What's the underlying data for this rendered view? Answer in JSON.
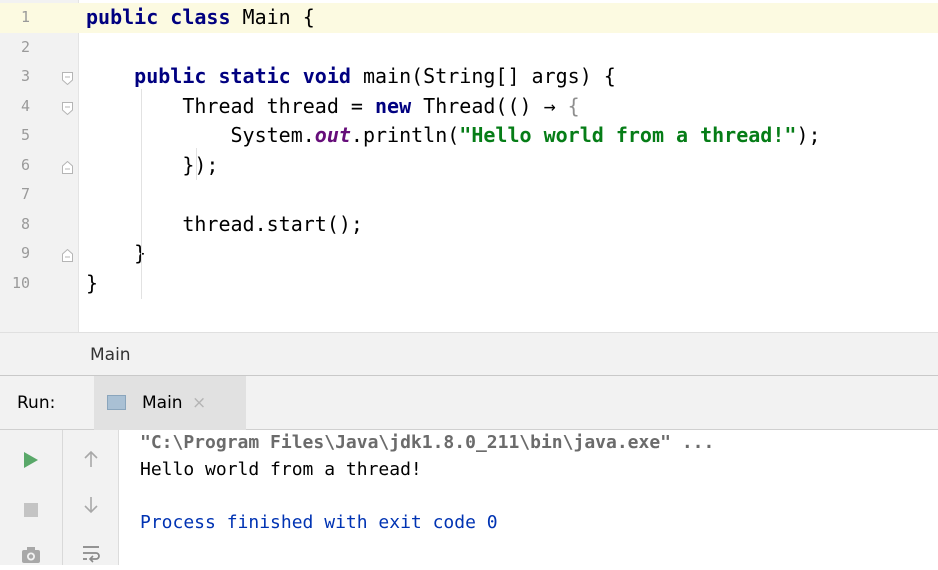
{
  "editor": {
    "lines": [
      {
        "number": "1",
        "parts": [
          {
            "t": "public class ",
            "c": "kw"
          },
          {
            "t": "Main {",
            "c": ""
          }
        ]
      },
      {
        "number": "2",
        "parts": []
      },
      {
        "number": "3",
        "parts": [
          {
            "t": "    ",
            "c": ""
          },
          {
            "t": "public static void ",
            "c": "kw"
          },
          {
            "t": "main(String[] args) {",
            "c": ""
          }
        ]
      },
      {
        "number": "4",
        "parts": [
          {
            "t": "        Thread thread = ",
            "c": ""
          },
          {
            "t": "new ",
            "c": "kw"
          },
          {
            "t": "Thread(() → ",
            "c": ""
          },
          {
            "t": "{",
            "c": "lambda-brace"
          }
        ]
      },
      {
        "number": "5",
        "parts": [
          {
            "t": "            System.",
            "c": ""
          },
          {
            "t": "out",
            "c": "fld"
          },
          {
            "t": ".println(",
            "c": ""
          },
          {
            "t": "\"Hello world from a thread!\"",
            "c": "str"
          },
          {
            "t": ");",
            "c": ""
          }
        ]
      },
      {
        "number": "6",
        "parts": [
          {
            "t": "        });",
            "c": ""
          }
        ]
      },
      {
        "number": "7",
        "parts": []
      },
      {
        "number": "8",
        "parts": [
          {
            "t": "        thread.start();",
            "c": ""
          }
        ]
      },
      {
        "number": "9",
        "parts": [
          {
            "t": "    }",
            "c": ""
          }
        ]
      },
      {
        "number": "10",
        "parts": [
          {
            "t": "}",
            "c": ""
          }
        ]
      }
    ],
    "current_line": 1,
    "fold_open_lines": [
      3,
      4
    ],
    "fold_close_lines": [
      6,
      9
    ]
  },
  "breadcrumb": {
    "text": "Main"
  },
  "run_panel": {
    "label": "Run:",
    "tab_label": "Main",
    "tab_close": "×",
    "console_lines": [
      {
        "text": "\"C:\\Program Files\\Java\\jdk1.8.0_211\\bin\\java.exe\" ...",
        "kind": "cmd"
      },
      {
        "text": "Hello world from a thread!",
        "kind": "out"
      },
      {
        "text": "",
        "kind": "out"
      },
      {
        "text": "Process finished with exit code 0",
        "kind": "exit"
      }
    ],
    "tools": {
      "run": "run-icon",
      "stop": "stop-icon",
      "camera": "camera-icon",
      "up": "up-arrow-icon",
      "down": "down-arrow-icon",
      "wrap": "soft-wrap-icon"
    }
  },
  "colors": {
    "keyword": "#000080",
    "string": "#067d17",
    "field": "#660e7a",
    "run_green": "#59a869",
    "current_line": "#fcfae1"
  }
}
